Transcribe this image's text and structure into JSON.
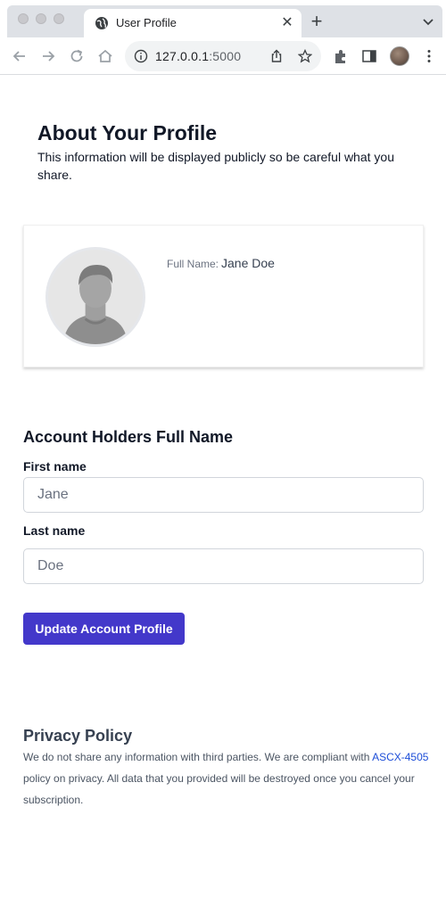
{
  "browser": {
    "tab_title": "User Profile",
    "url_host": "127.0.0.1",
    "url_port": ":5000",
    "icons": [
      "globe-icon",
      "close-icon",
      "plus-icon",
      "chevron-down-icon",
      "back-icon",
      "forward-icon",
      "reload-icon",
      "home-icon",
      "info-icon",
      "share-icon",
      "star-icon",
      "extensions-icon",
      "side-panel-icon",
      "profile-avatar",
      "kebab-menu-icon"
    ]
  },
  "header": {
    "title": "About Your Profile",
    "subtitle": "This information will be displayed publicly so be careful what you share."
  },
  "profile_card": {
    "full_name_label": "Full Name:",
    "full_name_value": "Jane Doe"
  },
  "form": {
    "section_title": "Account Holders Full Name",
    "first_name_label": "First name",
    "first_name_placeholder": "Jane",
    "last_name_label": "Last name",
    "last_name_placeholder": "Doe",
    "submit_label": "Update Account Profile"
  },
  "privacy": {
    "title": "Privacy Policy",
    "text_before": "We do not share any information with third parties. We are compliant with ",
    "link_text": "ASCX-4505",
    "text_after": " policy on privacy. All data that you provided will be destroyed once you cancel your subscription."
  },
  "colors": {
    "primary_button": "#4338ca",
    "link": "#1d4ed8"
  }
}
